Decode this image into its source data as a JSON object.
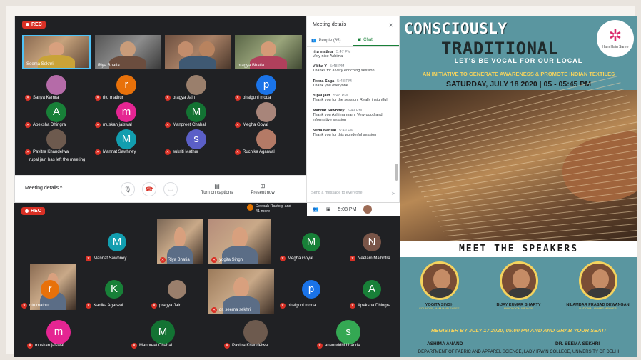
{
  "rec_label": "REC",
  "meeting1": {
    "participants_top": [
      {
        "name": "Seema Sekhri",
        "type": "photo",
        "cam": "#b89b72"
      },
      {
        "name": "Riya Bhatia",
        "type": "photo",
        "cam": "#7c7c7c"
      },
      {
        "name": "",
        "type": "photo",
        "cam": "#8d6e58"
      },
      {
        "name": "pragya Bhatia",
        "type": "photo",
        "cam": "#6b7c5b"
      }
    ],
    "participants": [
      {
        "name": "Sanya Kamra",
        "initial": "",
        "color": "#b56ba8",
        "type": "avatar-img"
      },
      {
        "name": "ritu mathur",
        "initial": "r",
        "color": "#e8710a",
        "type": "avatar"
      },
      {
        "name": "pragya Jain",
        "initial": "",
        "color": "#9a7f6c",
        "type": "avatar-img"
      },
      {
        "name": "phalguni moda",
        "initial": "p",
        "color": "#1a73e8",
        "type": "avatar"
      },
      {
        "name": "Apeksha Dhingra",
        "initial": "A",
        "color": "#188038",
        "type": "avatar"
      },
      {
        "name": "muskan jaiswal",
        "initial": "m",
        "color": "#e52592",
        "type": "avatar"
      },
      {
        "name": "Manpreet Chahal",
        "initial": "M",
        "color": "#137333",
        "type": "avatar"
      },
      {
        "name": "Megha Goyal",
        "initial": "",
        "color": "#a8857a",
        "type": "avatar-img"
      },
      {
        "name": "Pavitra Khandelwal",
        "initial": "",
        "color": "#6d5a4e",
        "type": "avatar-img"
      },
      {
        "name": "Mannat Sawhney",
        "initial": "M",
        "color": "#129eaf",
        "type": "avatar"
      },
      {
        "name": "sukriti Mathur",
        "initial": "s",
        "color": "#5b5fc7",
        "type": "avatar"
      },
      {
        "name": "Ruchika Agarwal",
        "initial": "",
        "color": "#b47a66",
        "type": "avatar-img"
      }
    ],
    "notice": "rupal jain has left the meeting",
    "controls": {
      "meeting_details": "Meeting details",
      "captions": "Turn on captions",
      "present": "Present now"
    },
    "chat": {
      "title": "Meeting details",
      "tab_people": "People (65)",
      "tab_chat": "Chat",
      "messages": [
        {
          "who": "ritu mathur",
          "time": "5:47 PM",
          "text": "Very nice Ashima"
        },
        {
          "who": "Vibha Y",
          "time": "5:48 PM",
          "text": "Thanks for a very enriching session!"
        },
        {
          "who": "Teena Saga",
          "time": "5:48 PM",
          "text": "Thank you everyone"
        },
        {
          "who": "rupal jain",
          "time": "5:48 PM",
          "text": "Thank you for the session. Really insightful"
        },
        {
          "who": "Mannat Sawhney",
          "time": "5:49 PM",
          "text": "Thank you Ashima mam. Very good and informative session"
        },
        {
          "who": "Neha Bansal",
          "time": "5:49 PM",
          "text": "Thank you for this wonderful session"
        }
      ],
      "placeholder": "Send a message to everyone"
    }
  },
  "meeting2": {
    "notification": "Deepak Rastogi and 41 more",
    "time": "5:08 PM",
    "participants": [
      {
        "name": "",
        "type": "photo",
        "initial": "",
        "color": "#8a6b52"
      },
      {
        "name": "Mannat Sawhney",
        "type": "avatar",
        "initial": "M",
        "color": "#129eaf"
      },
      {
        "name": "Riya Bhatia",
        "type": "photo",
        "initial": "",
        "color": "#7a6655"
      },
      {
        "name": "yogita Singh",
        "type": "photo",
        "initial": "",
        "color": "#b58c7a"
      },
      {
        "name": "Megha Goyal",
        "type": "avatar",
        "initial": "M",
        "color": "#188038"
      },
      {
        "name": "Neelam Malhotra",
        "type": "avatar",
        "initial": "N",
        "color": "#795548"
      },
      {
        "name": "ritu mathur",
        "type": "avatar",
        "initial": "r",
        "color": "#e8710a"
      },
      {
        "name": "Kanika Agarwal",
        "type": "avatar",
        "initial": "K",
        "color": "#188038"
      },
      {
        "name": "pragya Jain",
        "type": "avatar-img",
        "initial": "",
        "color": "#9a7f6c"
      },
      {
        "name": "dr. seema sekhri",
        "type": "photo",
        "initial": "",
        "color": "#9b7a5a"
      },
      {
        "name": "phalguni moda",
        "type": "avatar",
        "initial": "p",
        "color": "#1a73e8"
      },
      {
        "name": "Apeksha Dhingra",
        "type": "avatar",
        "initial": "A",
        "color": "#188038"
      },
      {
        "name": "muskan jaiswal",
        "type": "avatar",
        "initial": "m",
        "color": "#e52592"
      },
      {
        "name": "Manpreet Chahal",
        "type": "avatar",
        "initial": "M",
        "color": "#137333"
      },
      {
        "name": "Pavitra Khandelwal",
        "type": "avatar-img",
        "initial": "",
        "color": "#6d5a4e"
      },
      {
        "name": "anannddhi bhadria",
        "type": "avatar",
        "initial": "s",
        "color": "#34a853"
      }
    ]
  },
  "poster": {
    "title1": "CONSCIOUSLY",
    "title2": "TRADITIONAL",
    "logo_caption": "Ham Hain Saree",
    "vocal": "LET'S BE VOCAL FOR OUR LOCAL",
    "initiative": "AN INITIATIVE TO GENERATE AWARENESS & PROMOTE INDIAN TEXTILES",
    "date": "SATURDAY, JULY 18 2020 | 05 - 05:45 PM",
    "meet": "MEET THE SPEAKERS",
    "speakers": [
      {
        "name": "YOGITA SINGH",
        "role": "FOUNDER, HAM HAIN SAREE"
      },
      {
        "name": "BIJAY KUMAR BHARTY",
        "role": "HANDLOOM WEAVER"
      },
      {
        "name": "NILAMBAR PRASAD DEWANGAN",
        "role": "NATIONAL AWARD WINNER"
      }
    ],
    "register": "REGISTER BY JULY 17 2020, 05:00 PM AND AND GRAB YOUR SEAT!",
    "host1": "ASHIMA ANAND",
    "host2": "DR. SEEMA SEKHRI",
    "department": "DEPARTMENT OF FABRIC AND APPAREL SCIENCE, LADY IRWIN COLLEGE, UNIVERSITY OF DELHI"
  }
}
